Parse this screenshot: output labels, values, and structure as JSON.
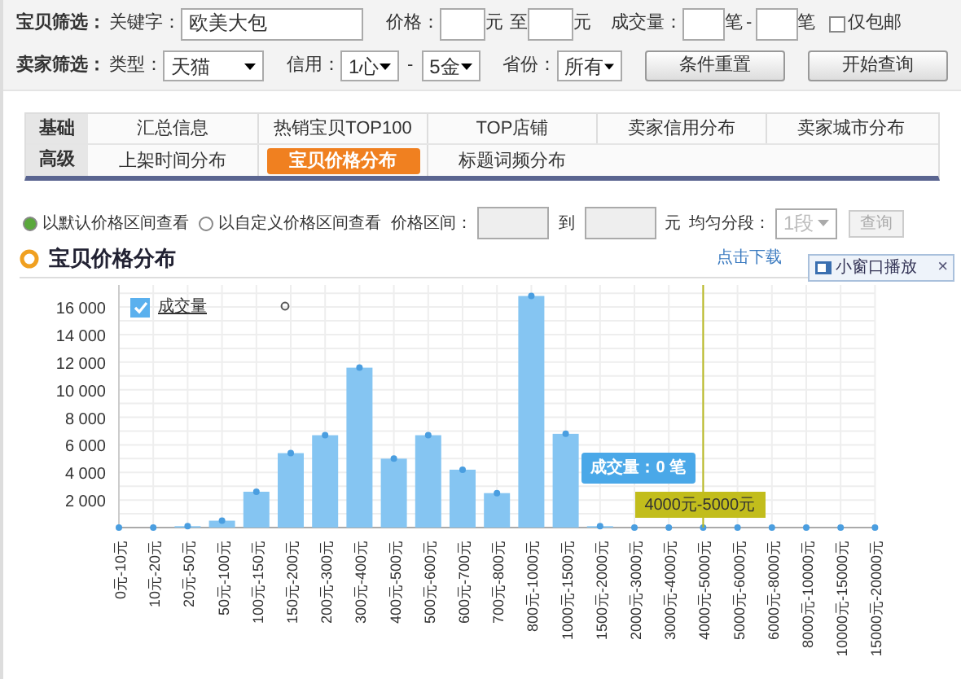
{
  "goods_filter": {
    "label": "宝贝筛选：",
    "keyword_label": "关键字：",
    "keyword": "欧美大包",
    "price_label": "价格：",
    "price_unit_1": "元",
    "price_to": "至",
    "price_unit_2": "元",
    "sales_label": "成交量：",
    "sales_unit_1": "笔",
    "sales_dash": "-",
    "sales_unit_2": "笔",
    "free_shipping": {
      "label": "仅包邮",
      "checked": false
    }
  },
  "seller_filter": {
    "label": "卖家筛选：",
    "type_label": "类型：",
    "type": "天猫",
    "credit_label": "信用：",
    "credit_from": "1心",
    "credit_dash": "-",
    "credit_to": "5金",
    "province_label": "省份：",
    "province": "所有",
    "buttons": [
      "条件重置",
      "开始查询"
    ]
  },
  "tabs": [
    {
      "group": "基础",
      "items": [
        {
          "label": "汇总信息",
          "selected": false
        },
        {
          "label": "热销宝贝TOP100",
          "selected": false
        },
        {
          "label": "TOP店铺",
          "selected": false
        },
        {
          "label": "卖家信用分布",
          "selected": false
        },
        {
          "label": "卖家城市分布",
          "selected": false
        }
      ]
    },
    {
      "group": "高级",
      "items": [
        {
          "label": "上架时间分布",
          "selected": false
        },
        {
          "label": "宝贝价格分布",
          "selected": true
        },
        {
          "label": "标题词频分布",
          "selected": false
        }
      ]
    }
  ],
  "range_options": {
    "radios": [
      {
        "label": "以默认价格区间查看",
        "selected": true
      },
      {
        "label": "以自定义价格区间查看",
        "selected": false
      }
    ],
    "range_label": "价格区间：",
    "to": "到",
    "unit": "元",
    "segments_label": "均匀分段：",
    "segments": "1段",
    "query": "查询",
    "disabled": true
  },
  "section": {
    "title": "宝贝价格分布",
    "download": "点击下载"
  },
  "popup": {
    "label": "小窗口播放",
    "close": "×"
  },
  "legend": {
    "checked": true
  },
  "tooltip": {
    "text": "成交量：0 笔",
    "category": "4000元-5000元"
  },
  "chart_data": {
    "type": "bar",
    "categories": [
      "0元-10元",
      "10元-20元",
      "20元-50元",
      "50元-100元",
      "100元-150元",
      "150元-200元",
      "200元-300元",
      "300元-400元",
      "400元-500元",
      "500元-600元",
      "600元-700元",
      "700元-800元",
      "800元-1000元",
      "1000元-1500元",
      "1500元-2000元",
      "2000元-3000元",
      "3000元-4000元",
      "4000元-5000元",
      "5000元-6000元",
      "6000元-8000元",
      "8000元-10000元",
      "10000元-15000元",
      "15000元-20000元"
    ],
    "series": [
      {
        "name": "成交量",
        "color": "#85c5f2",
        "values": [
          0,
          0,
          100,
          500,
          2600,
          5400,
          6700,
          11600,
          5000,
          6700,
          4200,
          2500,
          16800,
          6800,
          100,
          0,
          0,
          0,
          0,
          0,
          0,
          0,
          0
        ]
      }
    ],
    "grid": true,
    "ref_lines": [
      {
        "axis": "x",
        "value": "4000元-5000元",
        "color": "#b8b820"
      }
    ],
    "ylim": [
      0,
      17600
    ],
    "yticks": [
      {
        "value": 2000,
        "label": "2 000"
      },
      {
        "value": 4000,
        "label": "4 000"
      },
      {
        "value": 6000,
        "label": "6 000"
      },
      {
        "value": 8000,
        "label": "8 000"
      },
      {
        "value": 10000,
        "label": "10 000"
      },
      {
        "value": 12000,
        "label": "12 000"
      },
      {
        "value": 14000,
        "label": "14 000"
      },
      {
        "value": 16000,
        "label": "16 000"
      }
    ]
  }
}
